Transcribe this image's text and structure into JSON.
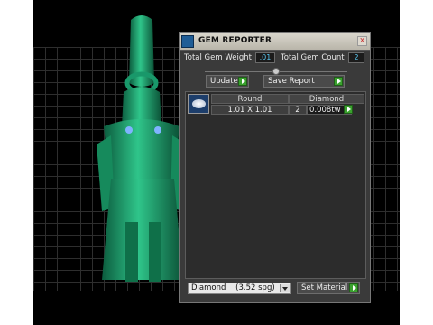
{
  "panel": {
    "title": "GEM REPORTER",
    "close_glyph": "x",
    "total_weight_label": "Total Gem Weight",
    "total_weight_value": ".01",
    "total_count_label": "Total Gem Count",
    "total_count_value": "2",
    "update_label": "Update",
    "save_label": "Save Report"
  },
  "table": {
    "headers": [
      "Round",
      "Diamond"
    ],
    "rows": [
      {
        "size": "1.01 X 1.01",
        "count": "2",
        "weight": "0.008tw"
      }
    ]
  },
  "material": {
    "selected": "Diamond    (3.52 spg)",
    "set_label": "Set Material"
  },
  "colors": {
    "model": "#1fa06f",
    "accent_button": "#3aa12e",
    "value_text": "#59c8f0"
  },
  "icons": [
    "gem-reporter-icon",
    "close-icon",
    "slider-knob-icon",
    "arrow-right-icon",
    "gem-thumbnail-icon",
    "chevron-down-icon"
  ]
}
